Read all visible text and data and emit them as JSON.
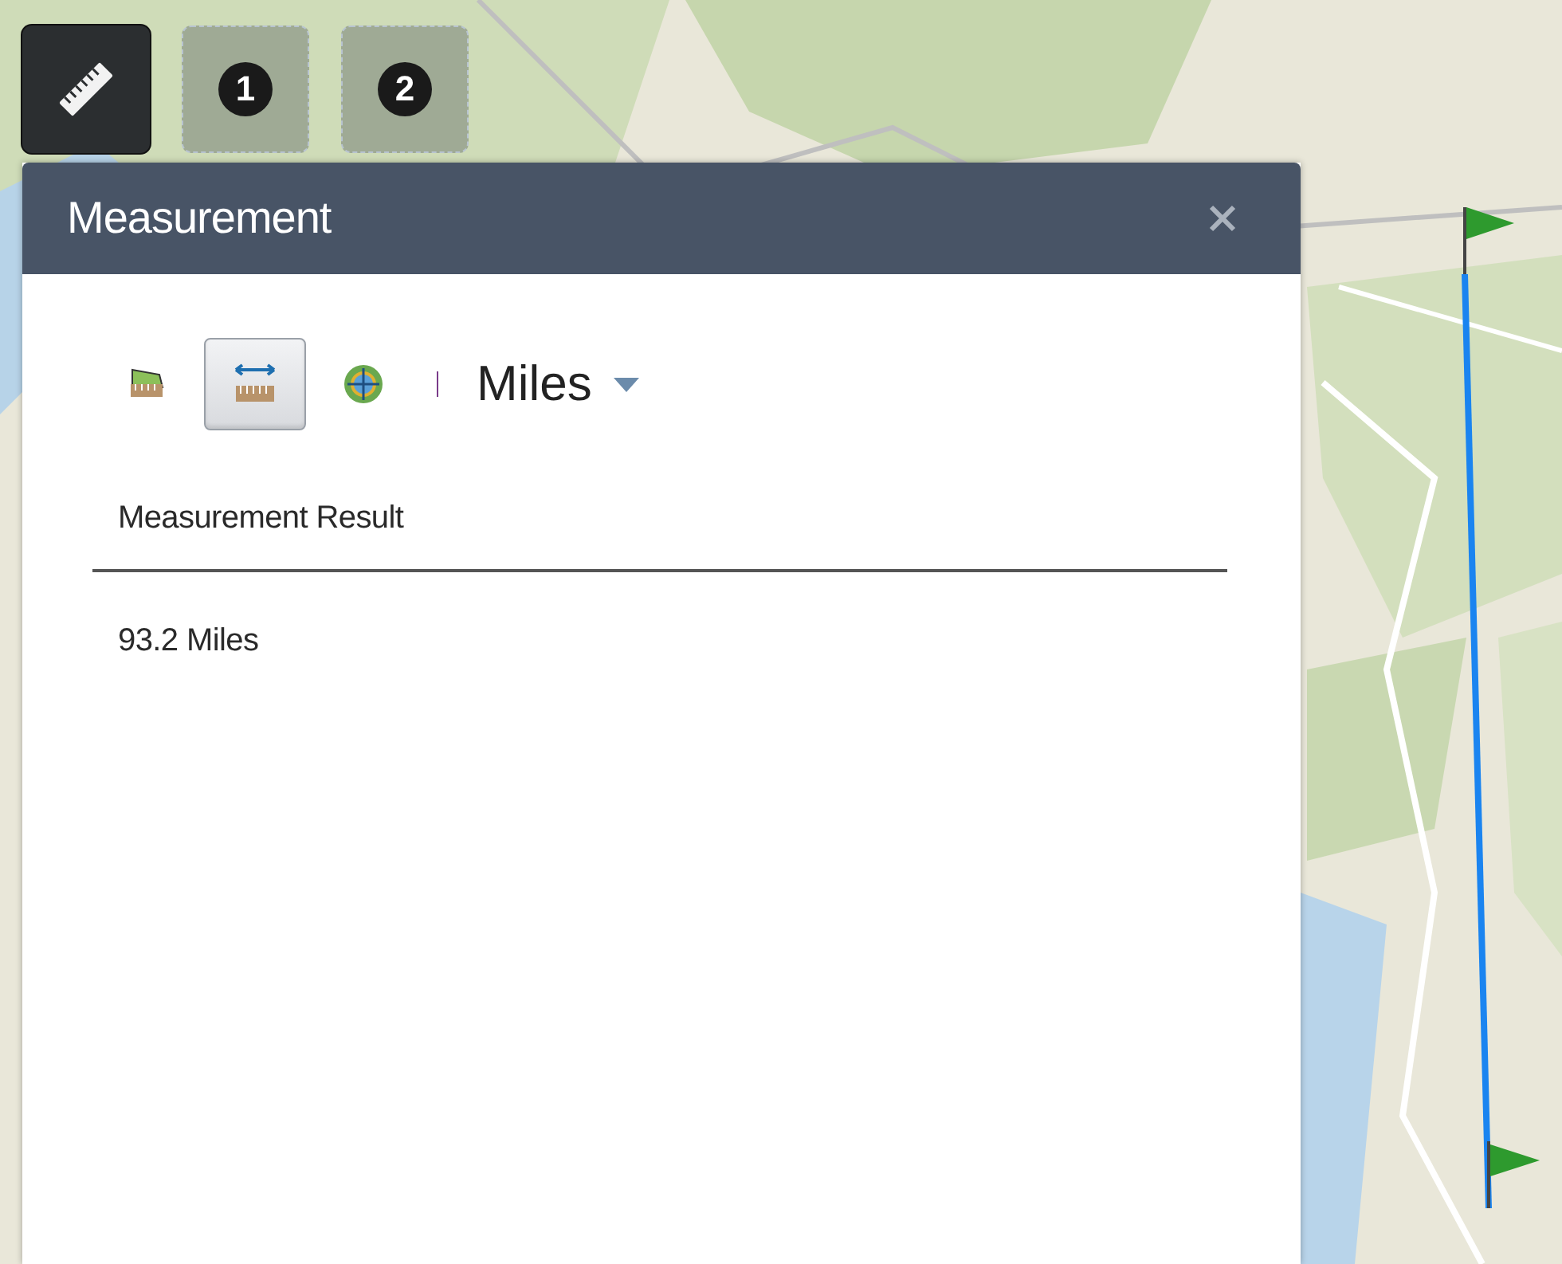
{
  "toolbar": [
    {
      "kind": "ruler",
      "selected": true
    },
    {
      "kind": "badge",
      "label": "1",
      "selected": false
    },
    {
      "kind": "badge",
      "label": "2",
      "selected": false
    }
  ],
  "panel": {
    "title": "Measurement",
    "tools": [
      {
        "kind": "area",
        "selected": false
      },
      {
        "kind": "distance",
        "selected": true
      },
      {
        "kind": "location",
        "selected": false
      }
    ],
    "unit": "Miles",
    "result_label": "Measurement Result",
    "result": "93.2 Miles"
  }
}
